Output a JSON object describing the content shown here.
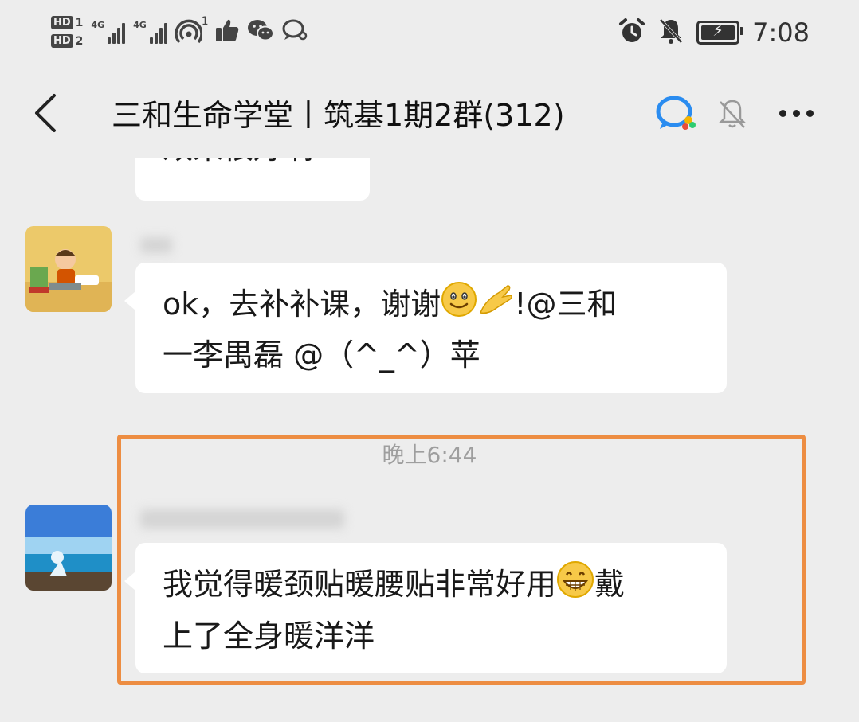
{
  "status_bar": {
    "sim1": "HD",
    "sim1_num": "1",
    "sim2": "HD",
    "sim2_num": "2",
    "network1": "4G",
    "network2": "4G",
    "hotspot_count": "1",
    "time": "7:08",
    "icons": [
      "hd-icon",
      "signal-icon",
      "hotspot-icon",
      "thumbs-up-icon",
      "wechat-icon",
      "chat-icon",
      "alarm-icon",
      "mute-icon",
      "battery-icon"
    ]
  },
  "header": {
    "title": "三和生命学堂丨筑基1期2群(312)",
    "icons": [
      "back-icon",
      "group-chat-icon",
      "mute-bell-icon",
      "more-icon"
    ]
  },
  "messages": [
    {
      "text": "效果很好啊",
      "partial": true
    },
    {
      "sender_blurred": true,
      "line1": "ok，去补补课，谢谢",
      "line1_suffix": "!@三和",
      "line2": "一李禺磊 @（^_^）苹",
      "emojis": [
        "smile-emoji",
        "ok-hand-emoji"
      ]
    },
    {
      "timestamp": "晚上6:44"
    },
    {
      "sender_blurred": true,
      "line1": "我觉得暖颈贴暖腰贴非常好用",
      "line1_suffix": "戴",
      "line2": "上了全身暖洋洋",
      "emojis": [
        "grin-emoji"
      ]
    }
  ],
  "colors": {
    "background": "#ededed",
    "bubble": "#ffffff",
    "highlight": "#ed8d42",
    "timestamp": "#9e9e9e"
  }
}
